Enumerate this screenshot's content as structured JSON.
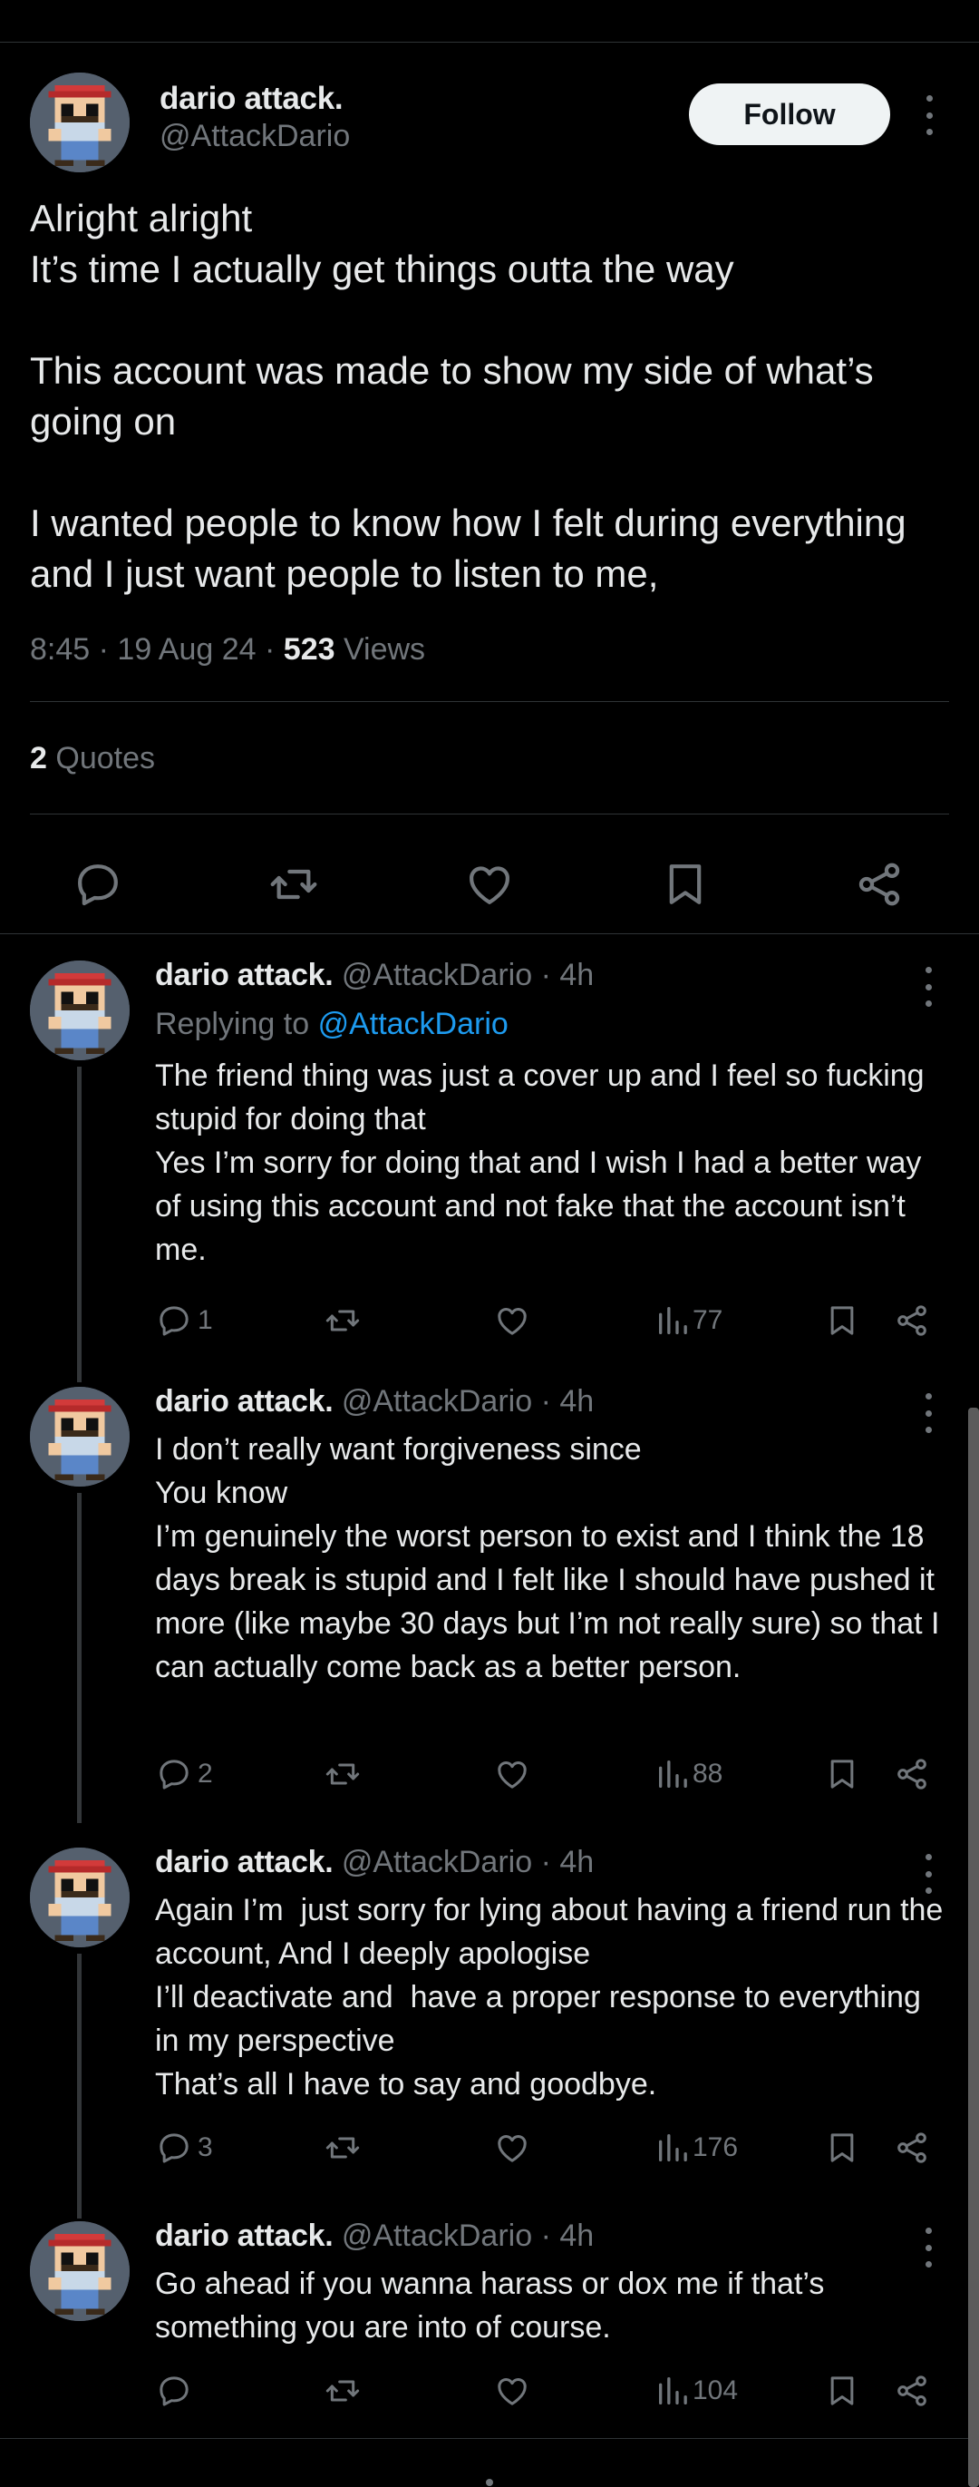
{
  "main_post": {
    "author_name": "dario attack.",
    "author_handle": "@AttackDario",
    "follow_label": "Follow",
    "text": "Alright alright\nIt’s time I actually get things outta the way\n\nThis account was made to show my side of what’s going on\n\nI wanted people to know how I felt during everything and I just want people to listen to me,",
    "time": "8:45",
    "date": "19 Aug 24",
    "views_count": "523",
    "views_label": "Views",
    "quotes_count": "2",
    "quotes_label": "Quotes",
    "actions": [
      "reply-icon",
      "repost-icon",
      "like-icon",
      "bookmark-icon",
      "share-icon"
    ]
  },
  "replies": [
    {
      "author_name": "dario attack.",
      "author_handle": "@AttackDario",
      "time_ago": "4h",
      "replying_prefix": "Replying to",
      "replying_to": "@AttackDario",
      "text": "The friend thing was just a cover up and I feel so fucking stupid for doing that\nYes I’m sorry for doing that and I wish I had a better way of using this account and not fake that the account isn’t me.",
      "reply_count": "1",
      "views": "77"
    },
    {
      "author_name": "dario attack.",
      "author_handle": "@AttackDario",
      "time_ago": "4h",
      "text": "I don’t really want forgiveness since\nYou know\nI’m genuinely the worst person to exist and I think the 18 days break is stupid and I felt like I should have pushed it more (like maybe 30 days but I’m not really sure) so that I can actually come back as a better person.",
      "reply_count": "2",
      "views": "88"
    },
    {
      "author_name": "dario attack.",
      "author_handle": "@AttackDario",
      "time_ago": "4h",
      "text": "Again I’m  just sorry for lying about having a friend run the account, And I deeply apologise\nI’ll deactivate and  have a proper response to everything in my perspective\nThat’s all I have to say and goodbye.",
      "reply_count": "3",
      "views": "176"
    },
    {
      "author_name": "dario attack.",
      "author_handle": "@AttackDario",
      "time_ago": "4h",
      "text": "Go ahead if you wanna harass or dox me if that’s something you are into of course.",
      "reply_count": "",
      "views": "104"
    }
  ],
  "colors": {
    "background": "#000000",
    "text": "#e7e9ea",
    "secondary": "#71767b",
    "link": "#1d9bf0",
    "divider": "#2f3336"
  }
}
